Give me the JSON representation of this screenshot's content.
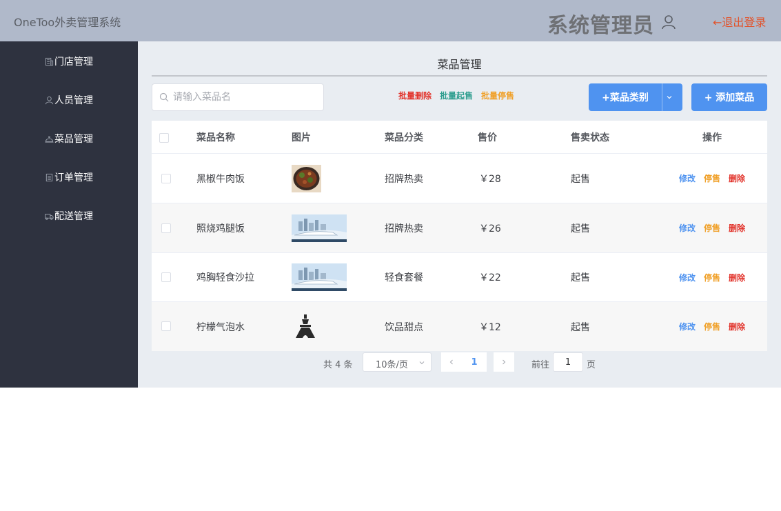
{
  "header": {
    "app_title": "OneToo外卖管理系统",
    "admin_name": "系统管理员",
    "logout": "←退出登录"
  },
  "sidebar": {
    "items": [
      {
        "label": "门店管理",
        "icon": "building-icon"
      },
      {
        "label": "人员管理",
        "icon": "person-icon"
      },
      {
        "label": "菜品管理",
        "icon": "dish-cover-icon"
      },
      {
        "label": "订单管理",
        "icon": "document-icon"
      },
      {
        "label": "配送管理",
        "icon": "truck-icon"
      }
    ]
  },
  "main": {
    "title": "菜品管理",
    "search_placeholder": "请输入菜品名",
    "batch_delete": "批量删除",
    "batch_on_sale": "批量起售",
    "batch_off_sale": "批量停售",
    "category_button": "+菜品类别",
    "add_button": "+ 添加菜品"
  },
  "table": {
    "columns": [
      "菜品名称",
      "图片",
      "菜品分类",
      "售价",
      "售卖状态",
      "操作"
    ],
    "rows": [
      {
        "name": "黑椒牛肉饭",
        "image": "food-photo",
        "category": "招牌热卖",
        "price": "￥28",
        "status": "起售"
      },
      {
        "name": "照烧鸡腿饭",
        "image": "train-photo",
        "category": "招牌热卖",
        "price": "￥26",
        "status": "起售"
      },
      {
        "name": "鸡胸轻食沙拉",
        "image": "train-photo",
        "category": "轻食套餐",
        "price": "￥22",
        "status": "起售"
      },
      {
        "name": "柠檬气泡水",
        "image": "tower-icon",
        "category": "饮品甜点",
        "price": "￥12",
        "status": "起售"
      }
    ],
    "actions": {
      "edit": "修改",
      "stop": "停售",
      "delete": "删除"
    }
  },
  "pagination": {
    "total": "共 4 条",
    "page_size": "10条/页",
    "current_page": "1",
    "goto_label": "前往",
    "goto_value": "1",
    "page_suffix": "页"
  },
  "colors": {
    "header_bg": "#b0b9ca",
    "sidebar_bg": "#2e323f",
    "main_bg": "#e9edf2",
    "primary": "#4f93f0",
    "danger": "#e2332b",
    "success": "#2f9e8f",
    "warning": "#f0a028"
  }
}
